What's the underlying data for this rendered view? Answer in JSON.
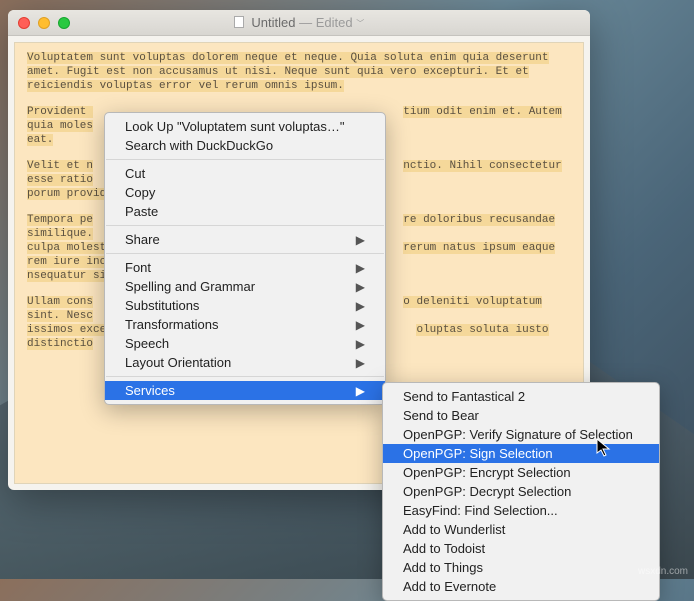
{
  "window": {
    "title": "Untitled",
    "subtitle": "— Edited"
  },
  "document": {
    "p1": "Voluptatem sunt voluptas dolorem neque et neque. Quia soluta enim quia deserunt amet. Fugit est non accusamus ut nisi. Neque sunt quia vero excepturi. Et et reiciendis voluptas error vel rerum omnis ipsum.",
    "p2a": "Provident ",
    "p2b": "tium odit enim et. Autem quia moles",
    "p2c": "eat.",
    "p3a": "Velit et n",
    "p3b": "nctio. Nihil consectetur esse ratio",
    "p3c": "porum provident porro sit. Est dolore",
    "p4a": "Tempora pe",
    "p4b": "re doloribus recusandae similique.",
    "p4c": "culpa molestias. Iure quaerat bea",
    "p4d": "rerum natus ipsum eaque rem iure incid",
    "p4e": "nsequatur sit aut laboriosam",
    "p5a": "Ullam cons",
    "p5b": "o deleniti voluptatum sint. Nesc",
    "p5c": "issimos excepturi neque. Et sit deb",
    "p5d": "oluptas soluta iusto distinctio"
  },
  "context_menu": {
    "lookup": "Look Up \"Voluptatem sunt voluptas…\"",
    "search": "Search with DuckDuckGo",
    "cut": "Cut",
    "copy": "Copy",
    "paste": "Paste",
    "share": "Share",
    "font": "Font",
    "spelling": "Spelling and Grammar",
    "substitutions": "Substitutions",
    "transformations": "Transformations",
    "speech": "Speech",
    "layout": "Layout Orientation",
    "services": "Services"
  },
  "services_submenu": {
    "items": [
      "Send to Fantastical 2",
      "Send to Bear",
      "OpenPGP: Verify Signature of Selection",
      "OpenPGP: Sign Selection",
      "OpenPGP: Encrypt Selection",
      "OpenPGP: Decrypt Selection",
      "EasyFind: Find Selection...",
      "Add to Wunderlist",
      "Add to Todoist",
      "Add to Things",
      "Add to Evernote"
    ],
    "highlighted_index": 3
  },
  "watermark": "wsxdn.com"
}
